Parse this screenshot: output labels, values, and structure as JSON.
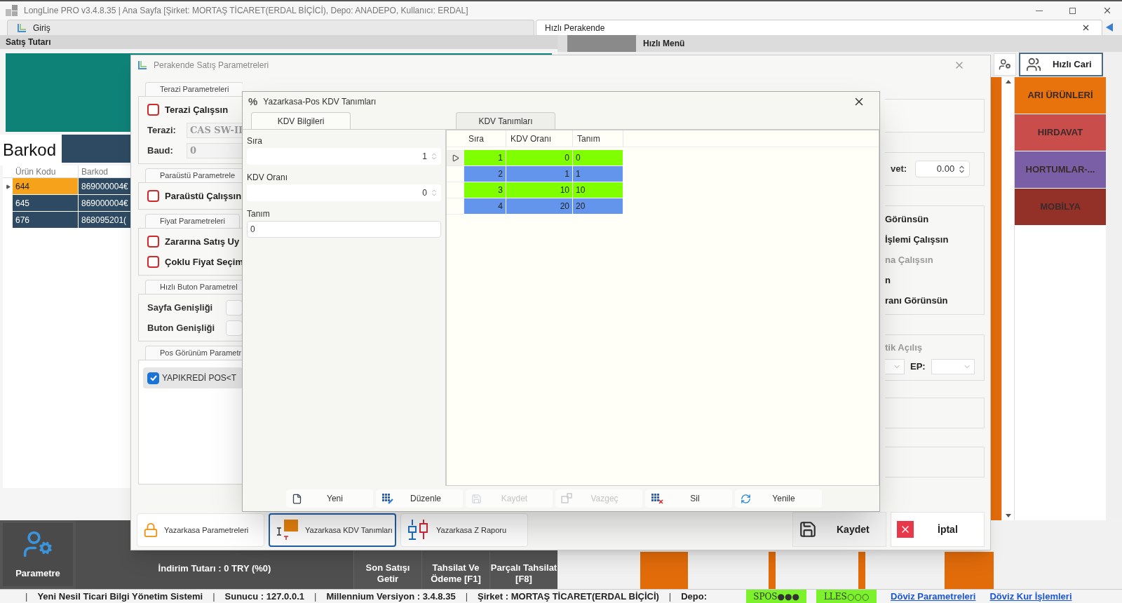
{
  "window": {
    "title": "LongLine PRO v3.4.8.35 | Ana Sayfa [Şirket: MORTAŞ TİCARET(ERDAL BİÇİCİ), Depo: ANADEPO, Kullanıcı: ERDAL]"
  },
  "tabs": [
    {
      "label": "Giriş",
      "selected": false
    },
    {
      "label": "Hızlı Perakende",
      "selected": true
    }
  ],
  "sales_panel": {
    "header": "Satış Tutarı",
    "barcode_label": "Barkod",
    "grid": {
      "columns": [
        "Ürün Kodu",
        "Barkod"
      ],
      "rows": [
        {
          "code": "644",
          "barcode": "869000004€",
          "selected": true
        },
        {
          "code": "645",
          "barcode": "869000004€",
          "selected": false
        },
        {
          "code": "676",
          "barcode": "868095201(",
          "selected": false
        }
      ]
    }
  },
  "quick_menu": {
    "header": "Hızlı Menü",
    "quick_customer": "Hızlı Cari",
    "categories": [
      {
        "label": "ARI ÜRÜNLERİ",
        "color": "#e8720c"
      },
      {
        "label": "HIRDAVAT",
        "color": "#c94d4b"
      },
      {
        "label": "HORTUMLAR-...",
        "color": "#7b5fa6"
      },
      {
        "label": "MOBİLYA",
        "color": "#933129"
      }
    ]
  },
  "bottom_bar": {
    "settings": "Parametre",
    "discount": "İndirim Tutarı : 0 TRY (%0)",
    "actions": [
      "Son Satışı Getir",
      "Tahsilat Ve Ödeme [F1]",
      "Parçalı Tahsilat [F8]"
    ]
  },
  "params_dialog": {
    "title": "Perakende Satış Parametreleri",
    "groups": [
      {
        "title": "Terazi Parametreleri",
        "items": [
          {
            "kind": "checkbox",
            "label": "Terazi Çalışsın",
            "checked": false
          },
          {
            "kind": "field",
            "label": "Terazi:",
            "value": "CAS SW-II"
          },
          {
            "kind": "field",
            "label": "Baud:",
            "value": "0"
          }
        ]
      },
      {
        "title": "Paraüstü Parametrele",
        "items": [
          {
            "kind": "checkbox",
            "label": "Paraüstü Çalışsın",
            "checked": false
          }
        ]
      },
      {
        "title": "Fiyat Parametreleri",
        "items": [
          {
            "kind": "checkbox",
            "label": "Zararına Satış Uy",
            "checked": false
          },
          {
            "kind": "checkbox",
            "label": "Çoklu Fiyat Seçim",
            "checked": false
          }
        ]
      },
      {
        "title": "Hızlı Buton Parametrel",
        "items": [
          {
            "kind": "field",
            "label": "Sayfa Genişliği"
          },
          {
            "kind": "field",
            "label": "Buton Genişliği"
          }
        ]
      },
      {
        "title": "Pos Görünüm Parametr",
        "items": [
          {
            "kind": "pos",
            "label": "YAPIKREDİ POS<T",
            "checked": true
          }
        ]
      }
    ],
    "rate": {
      "label": "vet:",
      "value": "0.00"
    },
    "options": [
      {
        "text": "Görünsün",
        "disabled": false
      },
      {
        "text": "İşlemi Çalışsın",
        "disabled": false
      },
      {
        "text": "na Çalışsın",
        "disabled": true
      },
      {
        "text": "n",
        "disabled": false
      },
      {
        "text": "ranı Görünsün",
        "disabled": false
      }
    ],
    "startup": {
      "text": "tik Açılış",
      "disabled": true
    },
    "port_label": "EP:",
    "footer_tabs": [
      {
        "label": "Yazarkasa Parametreleri",
        "selected": false
      },
      {
        "label": "Yazarkasa KDV Tanımları",
        "selected": true
      },
      {
        "label": "Yazarkasa Z Raporu",
        "selected": false
      }
    ],
    "save": "Kaydet",
    "cancel": "İptal"
  },
  "kdv_dialog": {
    "title": "Yazarkasa-Pos KDV Tanımları",
    "icon": "%",
    "tabs": [
      {
        "label": "KDV Bilgileri",
        "selected": true
      },
      {
        "label": "KDV Tanımları",
        "selected": false
      }
    ],
    "fields": [
      {
        "label": "Sıra",
        "value": "1",
        "kind": "spin"
      },
      {
        "label": "KDV Oranı",
        "value": "0",
        "kind": "spin"
      },
      {
        "label": "Tanım",
        "value": "0",
        "kind": "text"
      }
    ],
    "grid": {
      "columns": [
        "Sıra",
        "KDV Oranı",
        "Tanım"
      ],
      "rows": [
        {
          "cells": [
            "1",
            "0",
            "0"
          ],
          "color": "#7fff00",
          "selected": true
        },
        {
          "cells": [
            "2",
            "1",
            "1"
          ],
          "color": "#6495ed",
          "selected": false
        },
        {
          "cells": [
            "3",
            "10",
            "10"
          ],
          "color": "#7fff00",
          "selected": false
        },
        {
          "cells": [
            "4",
            "20",
            "20"
          ],
          "color": "#6495ed",
          "selected": false
        }
      ]
    },
    "toolbar": [
      {
        "label": "Yeni",
        "kind": "new",
        "disabled": false
      },
      {
        "label": "Düzenle",
        "kind": "edit",
        "disabled": false
      },
      {
        "label": "Kaydet",
        "kind": "save",
        "disabled": true
      },
      {
        "label": "Vazgeç",
        "kind": "undo",
        "disabled": true
      },
      {
        "label": "Sil",
        "kind": "delete",
        "disabled": false
      },
      {
        "label": "Yenile",
        "kind": "refresh",
        "disabled": false
      }
    ]
  },
  "status_bar": {
    "items": [
      {
        "kind": "sep",
        "text": "|"
      },
      {
        "kind": "text",
        "text": "Yeni Nesil Ticari Bilgi Yönetim Sistemi"
      },
      {
        "kind": "sep",
        "text": "|"
      },
      {
        "kind": "text",
        "text": "Sunucu :  127.0.0.1"
      },
      {
        "kind": "sep",
        "text": "|"
      },
      {
        "kind": "text",
        "text": "Millennium Versiyon :   3.4.8.35"
      },
      {
        "kind": "sep",
        "text": "|"
      },
      {
        "kind": "text",
        "text": "Şirket :  MORTAŞ TİCARET(ERDAL BİÇİCİ)"
      },
      {
        "kind": "sep",
        "text": "|"
      },
      {
        "kind": "text",
        "text": "Depo:"
      }
    ],
    "indicators": [
      "SPOS●●●",
      "LLES○○○"
    ],
    "links": [
      "Döviz Parametreleri",
      "Döviz Kur İşlemleri"
    ]
  }
}
